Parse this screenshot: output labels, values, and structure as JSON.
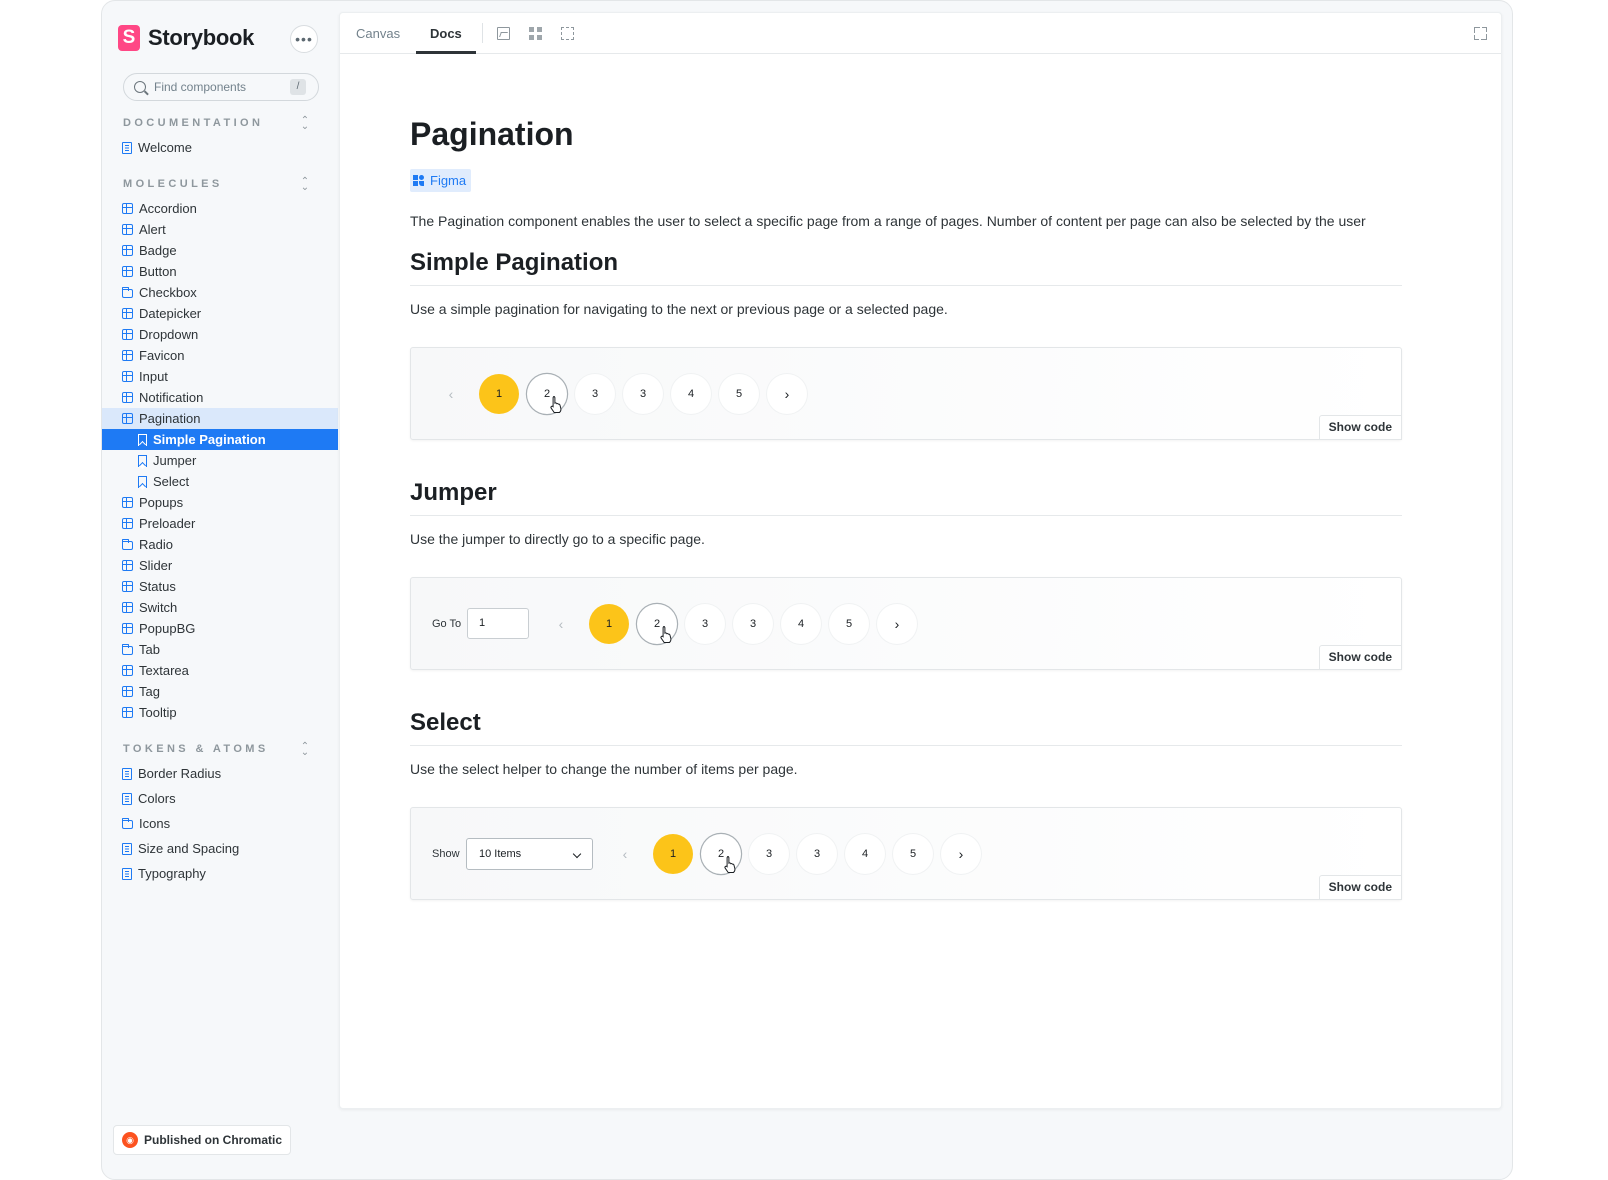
{
  "sidebar": {
    "brand": "Storybook",
    "brand_logo_letter": "S",
    "more_label": "•••",
    "search": {
      "placeholder": "Find components",
      "shortcut": "/"
    },
    "sections": {
      "documentation": {
        "title": "DOCUMENTATION",
        "items": [
          "Welcome"
        ]
      },
      "molecules": {
        "title": "MOLECULES",
        "items": [
          "Accordion",
          "Alert",
          "Badge",
          "Button",
          "Checkbox",
          "Datepicker",
          "Dropdown",
          "Favicon",
          "Input",
          "Notification",
          "Pagination",
          "Simple Pagination",
          "Jumper",
          "Select",
          "Popups",
          "Preloader",
          "Radio",
          "Slider",
          "Status",
          "Switch",
          "PopupBG",
          "Tab",
          "Textarea",
          "Tag",
          "Tooltip"
        ]
      },
      "tokens": {
        "title": "TOKENS & ATOMS",
        "items": [
          "Border Radius",
          "Colors",
          "Icons",
          "Size and Spacing",
          "Typography"
        ]
      }
    },
    "chromatic_badge": "Published on Chromatic"
  },
  "toolbar": {
    "tabs": [
      "Canvas",
      "Docs"
    ],
    "active_tab": "Docs"
  },
  "doc": {
    "title": "Pagination",
    "figma_label": "Figma",
    "intro": "The Pagination component enables the user to select a specific page from a range of pages. Number of content per page can also be selected by the user",
    "show_code": "Show code",
    "pages": [
      "1",
      "2",
      "3",
      "3",
      "4",
      "5"
    ],
    "prev_glyph": "‹",
    "next_glyph": "›",
    "sections": [
      {
        "title": "Simple Pagination",
        "desc": "Use a simple pagination for navigating to the next or previous page or a selected page."
      },
      {
        "title": "Jumper",
        "desc": "Use the jumper to directly go to a specific page.",
        "goto_label": "Go To",
        "goto_value": "1"
      },
      {
        "title": "Select",
        "desc": "Use the select helper to change the number of items per page.",
        "show_label": "Show",
        "select_value": "10 Items"
      }
    ]
  },
  "colors": {
    "accent": "#1e7af4",
    "brand": "#ff4785",
    "current_page": "#fcc419",
    "chromatic": "#fc521f"
  }
}
